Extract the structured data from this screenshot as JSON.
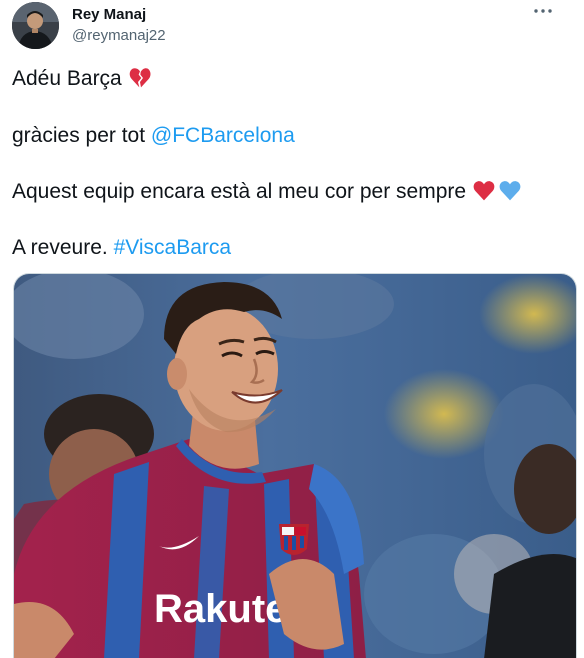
{
  "author": {
    "display_name": "Rey Manaj",
    "handle": "@reymanaj22"
  },
  "icons": {
    "more": "ellipsis-icon",
    "broken_heart": "broken-heart-emoji",
    "red_heart": "red-heart-emoji",
    "blue_heart": "blue-heart-emoji"
  },
  "tweet": {
    "line1_text": "Adéu Barça ",
    "line2_text": "gràcies per tot ",
    "line2_mention": "@FCBarcelona",
    "line3_text": "Aquest equip encara està al meu cor per sempre ",
    "line4_text": "A reveure. ",
    "line4_hashtag": "#ViscaBarca"
  },
  "media": {
    "jersey_sponsor": "Rakuten"
  },
  "colors": {
    "link": "#1d9bf0",
    "text": "#0f1419",
    "secondary": "#536471",
    "broken_heart": "#dd2e44",
    "red_heart": "#dd2e44",
    "blue_heart": "#5dadec"
  }
}
